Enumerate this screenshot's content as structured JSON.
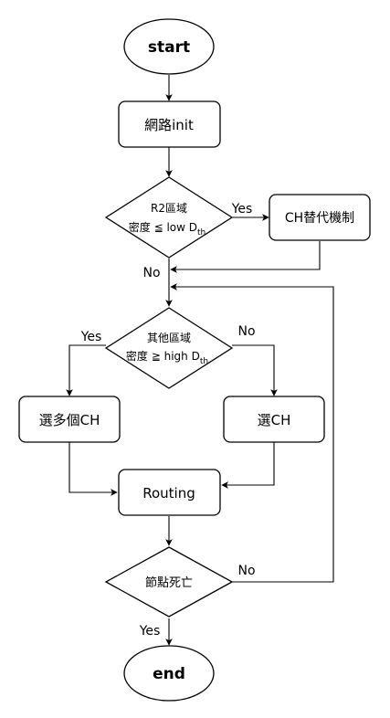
{
  "nodes": {
    "start": "start",
    "init": "網路init",
    "d1_line1": "R2區域",
    "d1_line2_main": "密度 ≦ low D",
    "d1_line2_sub": "th",
    "ch_replace": "CH替代機制",
    "d2_line1": "其他區域",
    "d2_line2_main": "密度 ≧ high D",
    "d2_line2_sub": "th",
    "multi_ch": "選多個CH",
    "one_ch": "選CH",
    "routing": "Routing",
    "d3": "節點死亡",
    "end": "end"
  },
  "edge_labels": {
    "d1_yes": "Yes",
    "d1_no": "No",
    "d2_yes": "Yes",
    "d2_no": "No",
    "d3_no": "No",
    "d3_yes": "Yes"
  }
}
